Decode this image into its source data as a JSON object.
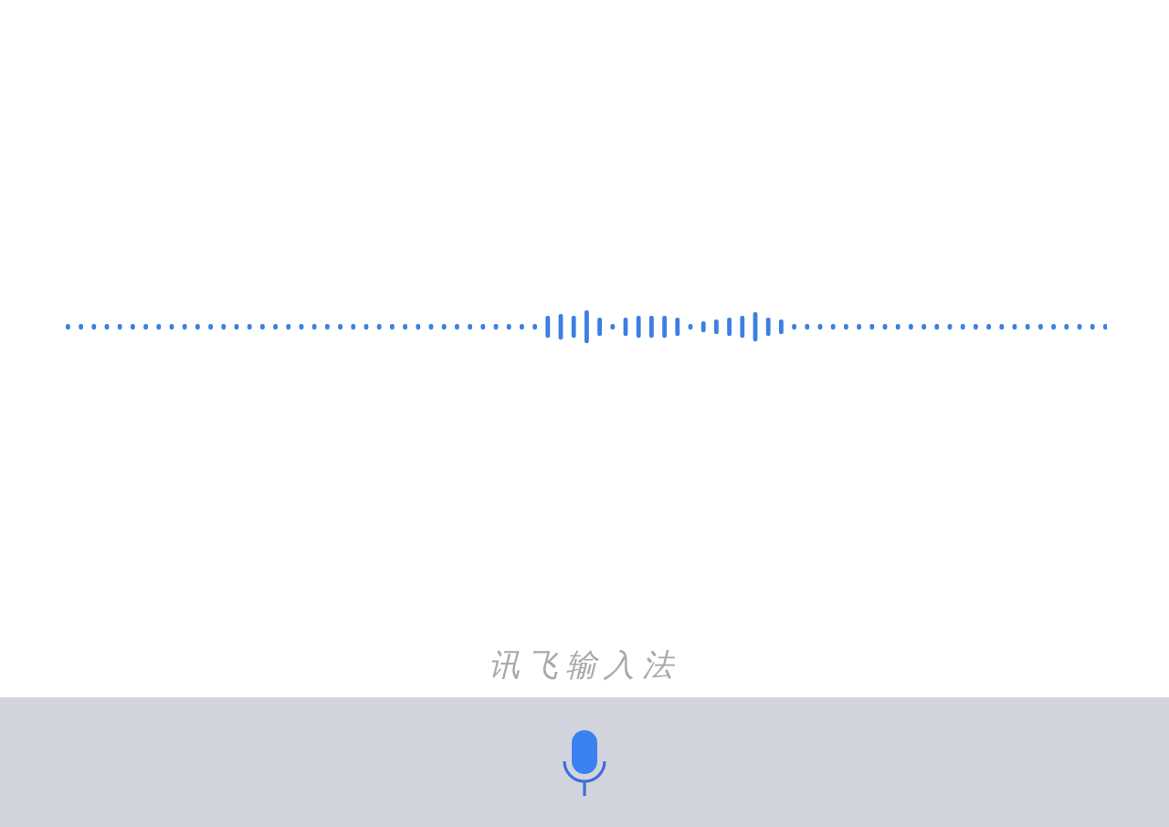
{
  "brand_label": "讯飞输入法"
}
